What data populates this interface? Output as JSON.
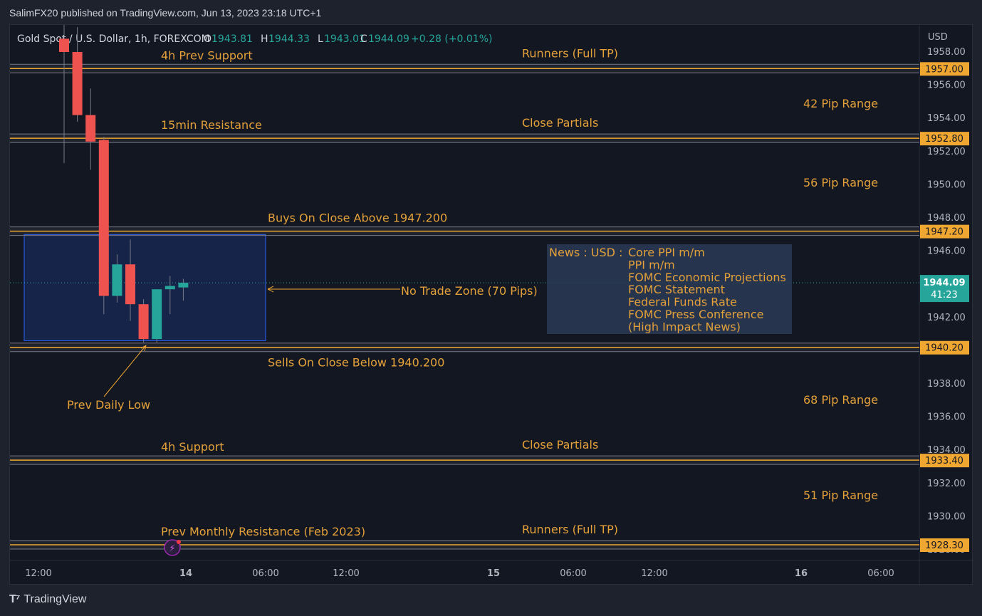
{
  "header": {
    "published": "SalimFX20 published on TradingView.com, Jun 13, 2023 23:18 UTC+1"
  },
  "footer": {
    "brand": "TradingView"
  },
  "chart_data": {
    "type": "candlestick",
    "symbol": "Gold Spot / U.S. Dollar, 1h, FOREXCOM",
    "ohlc_legend": {
      "o_label": "O",
      "o": "1943.81",
      "h_label": "H",
      "h": "1944.33",
      "l_label": "L",
      "l": "1943.01",
      "c_label": "C",
      "c": "1944.09",
      "change": "+0.28 (+0.01%)"
    },
    "currency": "USD",
    "y_ticks": [
      "1958.00",
      "1956.00",
      "1954.00",
      "1952.00",
      "1950.00",
      "1948.00",
      "1946.00",
      "1944.00",
      "1942.00",
      "1940.00",
      "1938.00",
      "1936.00",
      "1934.00",
      "1932.00",
      "1930.00",
      "1928.00"
    ],
    "x_ticks": [
      "12:00",
      "14",
      "06:00",
      "12:00",
      "15",
      "06:00",
      "12:00",
      "16",
      "06:00"
    ],
    "candles": [
      {
        "o": 1958.8,
        "h": 1960.0,
        "l": 1951.3,
        "c": 1958.0
      },
      {
        "o": 1958.0,
        "h": 1959.5,
        "l": 1953.8,
        "c": 1954.2
      },
      {
        "o": 1954.2,
        "h": 1955.8,
        "l": 1950.9,
        "c": 1952.6
      },
      {
        "o": 1952.7,
        "h": 1952.9,
        "l": 1942.2,
        "c": 1943.3
      },
      {
        "o": 1943.3,
        "h": 1945.8,
        "l": 1942.9,
        "c": 1945.2
      },
      {
        "o": 1945.2,
        "h": 1946.7,
        "l": 1941.8,
        "c": 1942.8
      },
      {
        "o": 1942.8,
        "h": 1943.1,
        "l": 1940.5,
        "c": 1940.7
      },
      {
        "o": 1940.7,
        "h": 1943.7,
        "l": 1940.5,
        "c": 1943.7
      },
      {
        "o": 1943.7,
        "h": 1944.5,
        "l": 1942.2,
        "c": 1943.9
      },
      {
        "o": 1943.81,
        "h": 1944.33,
        "l": 1943.01,
        "c": 1944.09
      }
    ],
    "levels": [
      {
        "price": "1957.00",
        "left_label": "4h Prev Support",
        "mid_label": "Runners (Full TP)"
      },
      {
        "price": "1952.80",
        "left_label": "15min Resistance",
        "mid_label": "Close Partials"
      },
      {
        "price": "1947.20",
        "left_label": "Buys On Close Above 1947.200",
        "mid_label": ""
      },
      {
        "price": "1940.20",
        "left_label": "Sells On Close Below 1940.200",
        "mid_label": ""
      },
      {
        "price": "1933.40",
        "left_label": "4h Support",
        "mid_label": "Close Partials"
      },
      {
        "price": "1928.30",
        "left_label": "Prev Monthly Resistance (Feb 2023)",
        "mid_label": "Runners (Full TP)"
      }
    ],
    "ranges": [
      "42 Pip Range",
      "56 Pip Range",
      "68 Pip Range",
      "51 Pip Range"
    ],
    "zone_label": "No Trade Zone (70 Pips)",
    "prev_low_label": "Prev Daily Low",
    "news": {
      "prefix": "News : USD :",
      "items": [
        "Core PPI m/m",
        "PPI m/m",
        "FOMC Economic Projections",
        "FOMC Statement",
        "Federal Funds Rate",
        "FOMC Press Conference",
        "(High Impact News)"
      ]
    },
    "current_price": "1944.09",
    "countdown": "41:23",
    "colors": {
      "up": "#26a69a",
      "down": "#ef5350",
      "level": "#f0a732",
      "label": "#e4a13a",
      "zone": "#2962ff",
      "news_bg": "#2a3a55"
    }
  }
}
